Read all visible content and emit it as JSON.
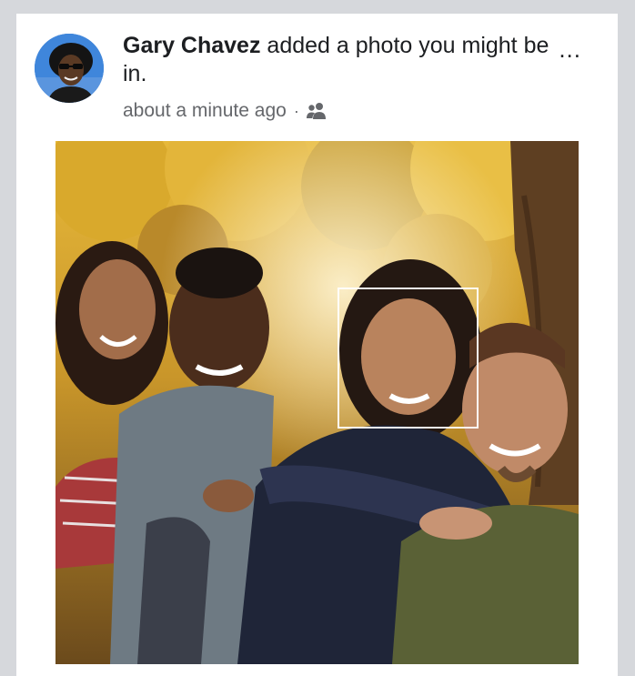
{
  "post": {
    "author": "Gary Chavez",
    "action": " added a photo you might be in.",
    "timestamp": "about a minute ago",
    "separator": "·",
    "more_label": "...",
    "audience_icon": "friends-icon"
  },
  "avatar": {
    "icon": "profile-photo",
    "bg_color": "#3d7fd6"
  },
  "photo": {
    "icon": "group-photo-autumn",
    "tag_suggestion": "face-tag-box"
  }
}
